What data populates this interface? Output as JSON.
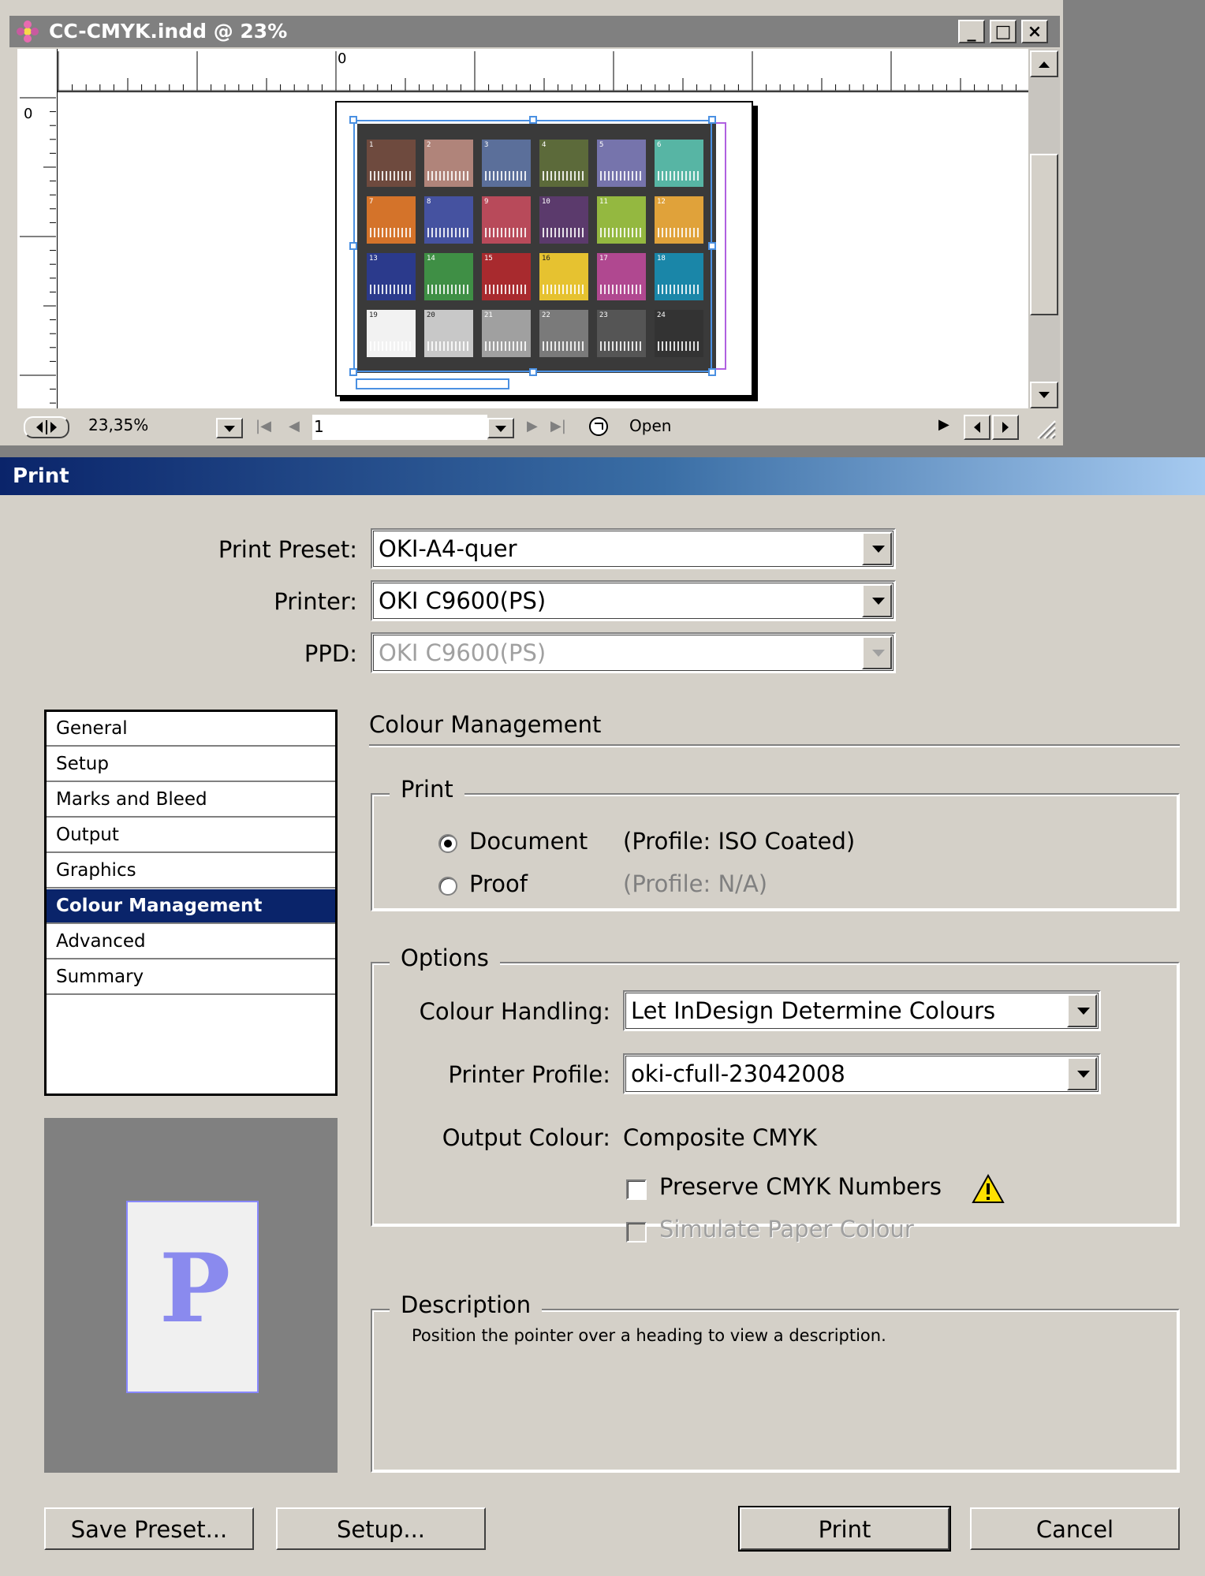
{
  "document_window": {
    "title": "CC-CMYK.indd @ 23%",
    "buttons": {
      "minimize": "_",
      "maximize": "□",
      "close": "×"
    },
    "ruler": {
      "h_zero": "0",
      "v_zero": "0"
    },
    "status": {
      "zoom": "23,35%",
      "page": "1",
      "state": "Open"
    },
    "patches": [
      {
        "n": "1",
        "color": "#6e4a3e"
      },
      {
        "n": "2",
        "color": "#b0847a"
      },
      {
        "n": "3",
        "color": "#5b6f9a"
      },
      {
        "n": "4",
        "color": "#5c6a3a"
      },
      {
        "n": "5",
        "color": "#7674ac"
      },
      {
        "n": "6",
        "color": "#57b5a4"
      },
      {
        "n": "7",
        "color": "#d4732a"
      },
      {
        "n": "8",
        "color": "#4552a0"
      },
      {
        "n": "9",
        "color": "#b84a5a"
      },
      {
        "n": "10",
        "color": "#5b3a6c"
      },
      {
        "n": "11",
        "color": "#94b840"
      },
      {
        "n": "12",
        "color": "#e0a23a"
      },
      {
        "n": "13",
        "color": "#2b3a8c"
      },
      {
        "n": "14",
        "color": "#3f8f45"
      },
      {
        "n": "15",
        "color": "#a82a2e"
      },
      {
        "n": "16",
        "color": "#e6c230"
      },
      {
        "n": "17",
        "color": "#b04890"
      },
      {
        "n": "18",
        "color": "#1a86a8"
      },
      {
        "n": "19",
        "color": "#f2f2f2"
      },
      {
        "n": "20",
        "color": "#c8c8c8"
      },
      {
        "n": "21",
        "color": "#a0a0a0"
      },
      {
        "n": "22",
        "color": "#7a7a7a"
      },
      {
        "n": "23",
        "color": "#555555"
      },
      {
        "n": "24",
        "color": "#333333"
      }
    ]
  },
  "dialog": {
    "title": "Print",
    "preset": {
      "label": "Print Preset:",
      "value": "OKI-A4-quer"
    },
    "printer": {
      "label": "Printer:",
      "value": "OKI C9600(PS)"
    },
    "ppd": {
      "label": "PPD:",
      "value": "OKI C9600(PS)"
    },
    "nav": [
      "General",
      "Setup",
      "Marks and Bleed",
      "Output",
      "Graphics",
      "Colour Management",
      "Advanced",
      "Summary"
    ],
    "nav_selected": "Colour Management",
    "preview_letter": "P",
    "section_title": "Colour Management",
    "print_group": {
      "title": "Print",
      "document": {
        "label": "Document",
        "profile": "(Profile: ISO Coated)",
        "selected": true
      },
      "proof": {
        "label": "Proof",
        "profile": "(Profile: N/A)",
        "selected": false
      }
    },
    "options_group": {
      "title": "Options",
      "colour_handling": {
        "label": "Colour Handling:",
        "value": "Let InDesign Determine Colours"
      },
      "printer_profile": {
        "label": "Printer Profile:",
        "value": "oki-cfull-23042008"
      },
      "output_colour": {
        "label": "Output Colour:",
        "value": "Composite CMYK"
      },
      "preserve_cmyk": {
        "label": "Preserve CMYK Numbers",
        "checked": false
      },
      "simulate_paper": {
        "label": "Simulate Paper Colour",
        "checked": false,
        "enabled": false
      },
      "warning_icon": "warning-icon"
    },
    "description_group": {
      "title": "Description",
      "text": "Position the pointer over a heading to view a description."
    },
    "buttons": {
      "save_preset": "Save Preset...",
      "setup": "Setup...",
      "print": "Print",
      "cancel": "Cancel"
    }
  }
}
